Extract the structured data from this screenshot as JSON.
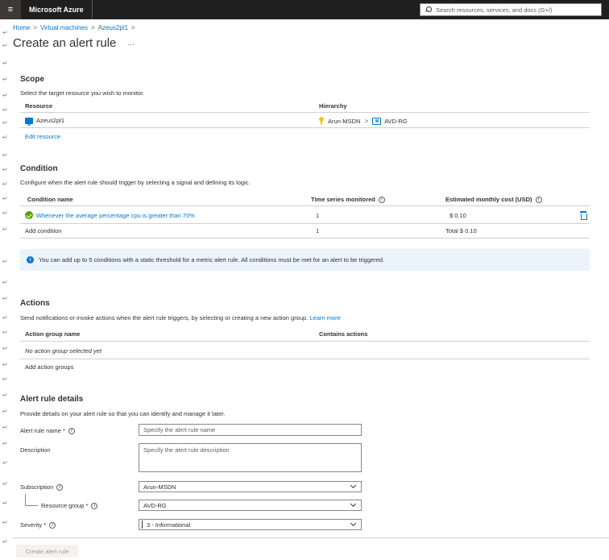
{
  "topbar": {
    "brand": "Microsoft Azure",
    "search_placeholder": "Search resources, services, and docs (G+/)"
  },
  "breadcrumb": [
    "Home",
    "Virtual machines",
    "Azeus2pl1"
  ],
  "breadcrumb_sep": ">",
  "page": {
    "title": "Create an alert rule",
    "more": "..."
  },
  "scope": {
    "title": "Scope",
    "description": "Select the target resource you wish to monitor.",
    "col_resource": "Resource",
    "col_hierarchy": "Hierarchy",
    "resource_name": "Azeus2pl1",
    "hierarchy_subscription": "Arun-MSDN",
    "hierarchy_sep": ">",
    "hierarchy_rg": "AVD-RG",
    "edit_link": "Edit resource"
  },
  "condition": {
    "title": "Condition",
    "description": "Configure when the alert rule should trigger by selecting a signal and defining its logic.",
    "col_name": "Condition name",
    "col_series": "Time series monitored",
    "col_cost": "Estimated monthly cost (USD)",
    "row_name": "Whenever the average percentage cpu is greater than 70%",
    "row_series": "1",
    "row_cost": "$ 0.10",
    "add_link": "Add condition",
    "total_series": "1",
    "total_cost": "Total $ 0.10",
    "info": "You can add up to 5 conditions with a static threshold for a metric alert rule. All conditions must be met for an alert to be triggered."
  },
  "actions": {
    "title": "Actions",
    "description": "Send notifications or invoke actions when the alert rule triggers, by selecting or creating a new action group.",
    "learn_more": "Learn more",
    "col_group": "Action group name",
    "col_contains": "Contains actions",
    "empty": "No action group selected yet",
    "add_link": "Add action groups"
  },
  "details": {
    "title": "Alert rule details",
    "description": "Provide details on your alert rule so that you can identify and manage it later.",
    "name_label": "Alert rule name *",
    "name_placeholder": "Specify the alert rule name",
    "desc_label": "Description",
    "desc_placeholder": "Specify the alert rule description",
    "subscription_label": "Subscription",
    "subscription_value": "Arun-MSDN",
    "rg_label": "Resource group *",
    "rg_value": "AVD-RG",
    "severity_label": "Severity *",
    "severity_value": "3 - Informational"
  },
  "footer": {
    "create_label": "Create alert rule"
  },
  "margin_mark": "↵",
  "info_glyph": "i"
}
